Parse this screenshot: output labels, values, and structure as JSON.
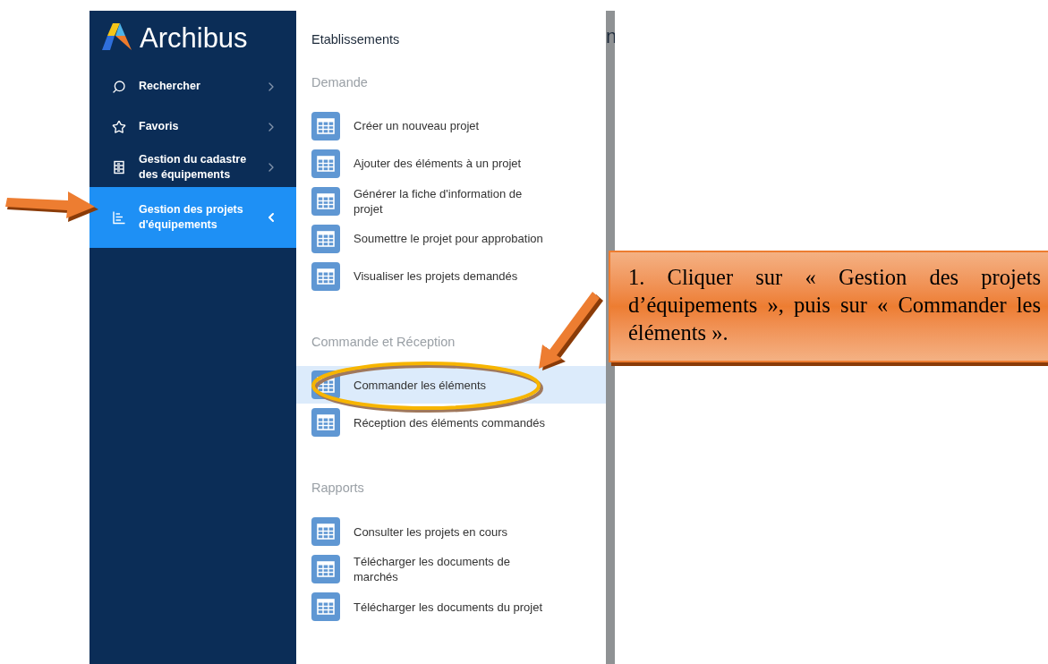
{
  "sidebar": {
    "logo": "Archibus",
    "items": [
      {
        "label": "Rechercher",
        "kind": "search",
        "selected": false
      },
      {
        "label": "Favoris",
        "kind": "star",
        "selected": false
      },
      {
        "label": "Gestion du cadastre des équipements",
        "kind": "cabinet",
        "selected": false
      },
      {
        "label": "Gestion des projets d'équipements",
        "kind": "chart",
        "selected": true
      }
    ]
  },
  "flyout": {
    "title": "Etablissements",
    "sections": [
      {
        "heading": "Demande",
        "items": [
          {
            "label": "Créer un nouveau projet",
            "selected": false
          },
          {
            "label": "Ajouter des éléments à un projet",
            "selected": false
          },
          {
            "label": "Générer la fiche d'information de projet",
            "selected": false
          },
          {
            "label": "Soumettre le projet pour approbation",
            "selected": false
          },
          {
            "label": "Visualiser les projets demandés",
            "selected": false
          }
        ]
      },
      {
        "heading": "Commande et Réception",
        "items": [
          {
            "label": "Commander les éléments",
            "selected": true
          },
          {
            "label": "Réception des éléments commandés",
            "selected": false
          }
        ]
      },
      {
        "heading": "Rapports",
        "items": [
          {
            "label": "Consulter les projets en cours",
            "selected": false
          },
          {
            "label": "Télécharger les documents de marchés",
            "selected": false
          },
          {
            "label": "Télécharger les documents du projet",
            "selected": false
          }
        ]
      }
    ]
  },
  "background_fragment": "n",
  "annotation": {
    "text": "1. Cliquer sur « Gestion des projets d’équipements », puis sur « Commander les éléments »."
  }
}
